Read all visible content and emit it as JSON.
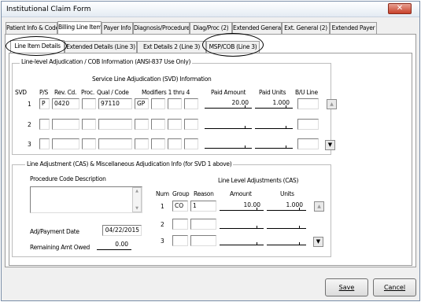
{
  "window": {
    "title": "Institutional Claim Form",
    "close_glyph": "✕"
  },
  "main_tabs": [
    "Patient Info & Codes",
    "Billing Line Items",
    "Payer Info",
    "Diagnosis/Procedure",
    "Diag/Proc (2)",
    "Extended General",
    "Ext. General (2)",
    "Extended Payer"
  ],
  "sub_tabs": [
    "Line Item Details",
    "Extended Details (Line 3)",
    "Ext Details 2 (Line 3)",
    "MSP/COB (Line 3)"
  ],
  "line_group": {
    "title": "Line-level Adjudication / COB Information (ANSI-837 Use Only)",
    "svd_title": "Service Line Adjudication (SVD) Information",
    "headers": {
      "svd": "SVD",
      "ps": "P/S",
      "rev": "Rev. Cd.",
      "proc": "Proc.",
      "qual": "Qual / Code",
      "mods": "Modifiers 1 thru 4",
      "paid_amount": "Paid Amount",
      "paid_units": "Paid Units",
      "bu_line": "B/U Line"
    },
    "rows": [
      {
        "num": "1",
        "ps": "P",
        "rev": "0420",
        "proc": "",
        "code": "97110",
        "mod1": "GP",
        "mod2": "",
        "mod3": "",
        "mod4": "",
        "paid_amount": "20.00",
        "paid_units": "1.000",
        "bu_line": ""
      },
      {
        "num": "2",
        "ps": "",
        "rev": "",
        "proc": "",
        "code": "",
        "mod1": "",
        "mod2": "",
        "mod3": "",
        "mod4": "",
        "paid_amount": "",
        "paid_units": "",
        "bu_line": ""
      },
      {
        "num": "3",
        "ps": "",
        "rev": "",
        "proc": "",
        "code": "",
        "mod1": "",
        "mod2": "",
        "mod3": "",
        "mod4": "",
        "paid_amount": "",
        "paid_units": "",
        "bu_line": ""
      }
    ]
  },
  "cas_group": {
    "title": "Line Adjustment (CAS) & Miscellaneous Adjudication Info (for SVD 1 above)",
    "proc_desc_label": "Procedure Code Description",
    "proc_desc_value": "",
    "adj_date_label": "Adj/Payment Date",
    "adj_date_value": "04/22/2015",
    "remaining_label": "Remaining Amt Owed",
    "remaining_value": "0.00",
    "cas_title": "Line Level Adjustments (CAS)",
    "headers": {
      "num": "Num",
      "group": "Group",
      "reason": "Reason",
      "amount": "Amount",
      "units": "Units"
    },
    "rows": [
      {
        "num": "1",
        "group": "CO",
        "reason": "1",
        "amount": "10.00",
        "units": "1.000"
      },
      {
        "num": "2",
        "group": "",
        "reason": "",
        "amount": "",
        "units": ""
      },
      {
        "num": "3",
        "group": "",
        "reason": "",
        "amount": "",
        "units": ""
      }
    ]
  },
  "buttons": {
    "save": "Save",
    "cancel": "Cancel"
  }
}
